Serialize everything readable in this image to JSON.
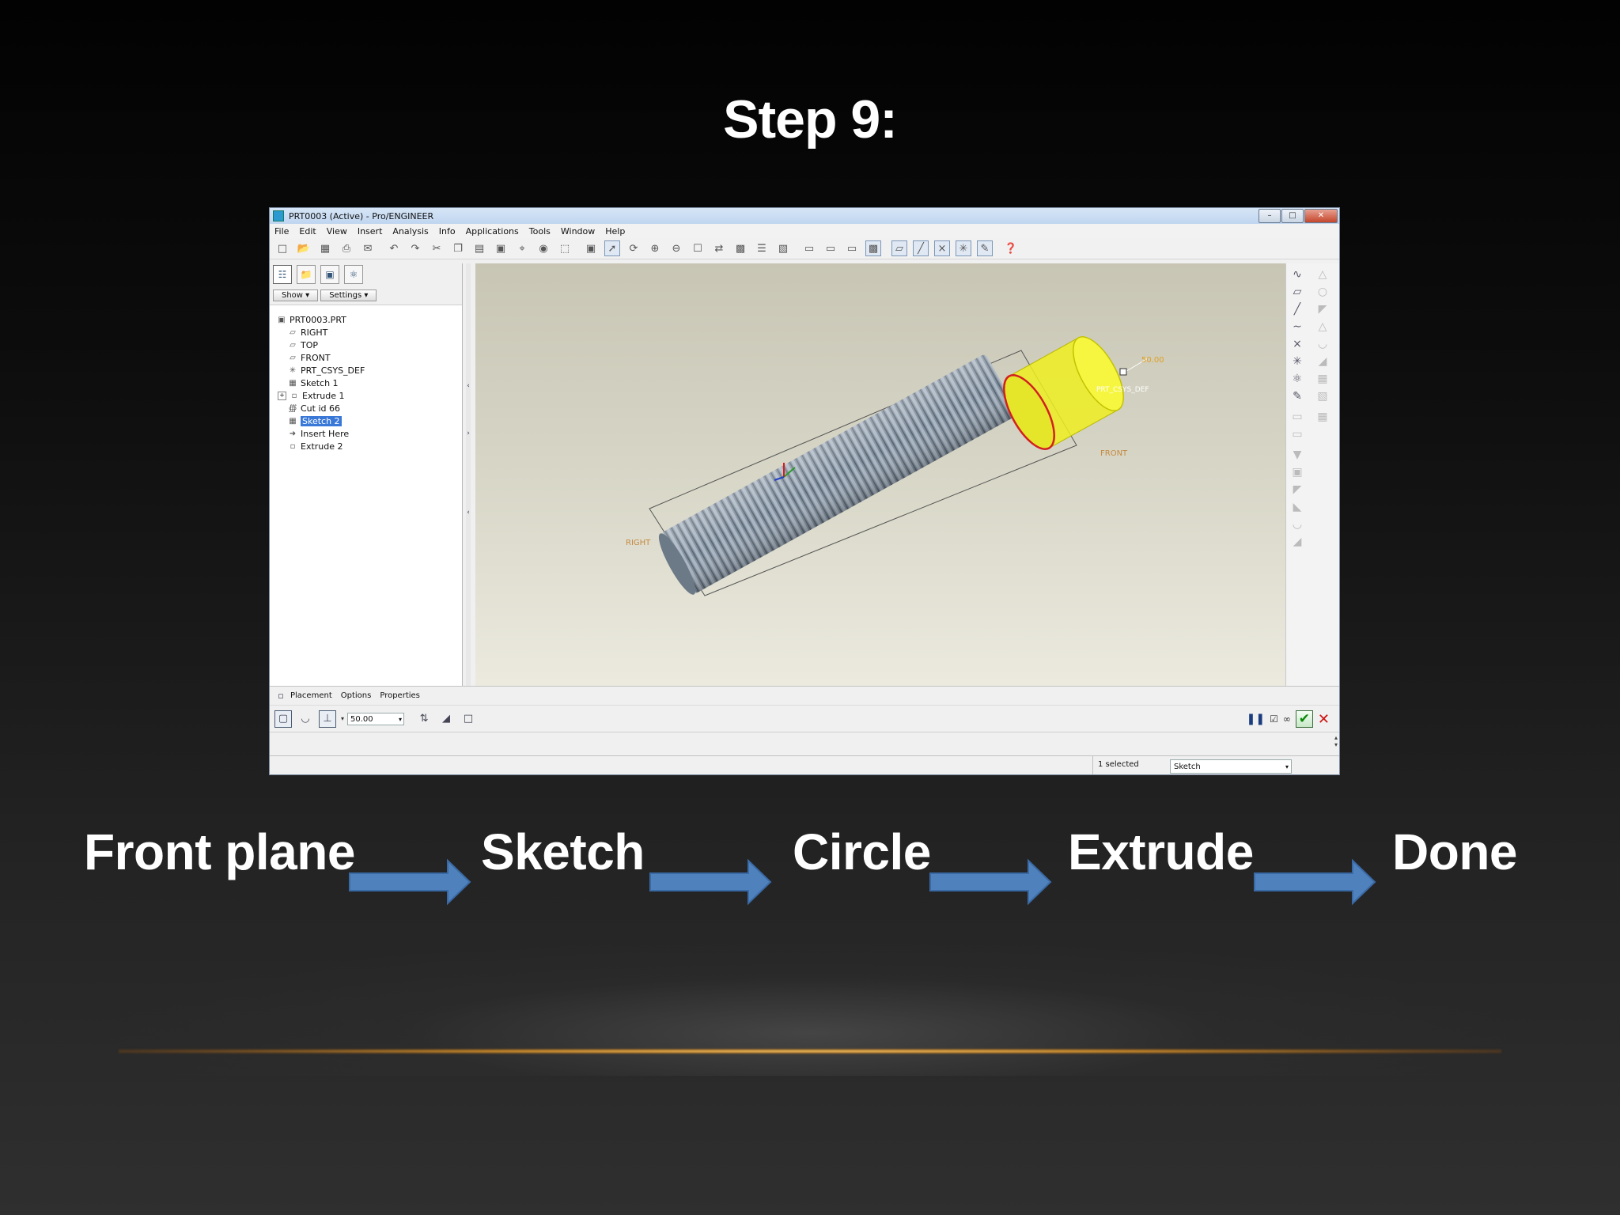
{
  "slide": {
    "title": "Step 9:",
    "workflow": [
      "Front plane",
      "Sketch",
      "Circle",
      "Extrude",
      "Done"
    ]
  },
  "window": {
    "title": "PRT0003 (Active) - Pro/ENGINEER",
    "menu": [
      "File",
      "Edit",
      "View",
      "Insert",
      "Analysis",
      "Info",
      "Applications",
      "Tools",
      "Window",
      "Help"
    ]
  },
  "model_tree": {
    "show_label": "Show",
    "settings_label": "Settings",
    "items": [
      {
        "label": "PRT0003.PRT",
        "icon": "part-icon"
      },
      {
        "label": "RIGHT",
        "icon": "datum-plane-icon"
      },
      {
        "label": "TOP",
        "icon": "datum-plane-icon"
      },
      {
        "label": "FRONT",
        "icon": "datum-plane-icon"
      },
      {
        "label": "PRT_CSYS_DEF",
        "icon": "csys-icon"
      },
      {
        "label": "Sketch 1",
        "icon": "sketch-icon"
      },
      {
        "label": "Extrude 1",
        "icon": "extrude-icon"
      },
      {
        "label": "Cut id 66",
        "icon": "cut-icon"
      },
      {
        "label": "Sketch 2",
        "icon": "sketch-icon"
      },
      {
        "label": "Insert Here",
        "icon": "insert-arrow-icon"
      },
      {
        "label": "Extrude 2",
        "icon": "extrude-icon"
      }
    ]
  },
  "viewport": {
    "labels": {
      "right": "RIGHT",
      "front": "FRONT",
      "csys": "PRT_CSYS_DEF",
      "dimension": "50.00"
    }
  },
  "dashboard": {
    "tabs": [
      "Placement",
      "Options",
      "Properties"
    ],
    "depth_value": "50.00"
  },
  "status": {
    "selected": "1 selected",
    "filter": "Sketch"
  },
  "colors": {
    "arrow_fill": "#4f81bd",
    "arrow_stroke": "#3a6aa6",
    "highlight_yellow": "#f2f230",
    "sketch_red": "#d22020"
  }
}
